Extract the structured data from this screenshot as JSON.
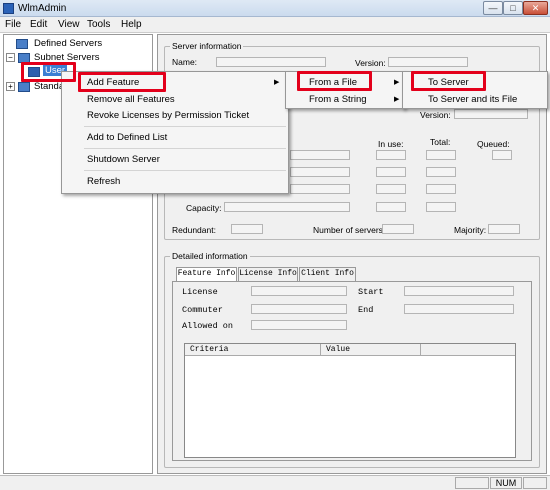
{
  "window": {
    "title": "WlmAdmin",
    "min_symbol": "—",
    "max_symbol": "□",
    "close_symbol": "✕"
  },
  "menubar": [
    "File",
    "Edit",
    "View",
    "Tools",
    "Help"
  ],
  "tree": {
    "defined_servers": "Defined Servers",
    "subnet_servers": "Subnet Servers",
    "selected_node": "User",
    "standalone": "Standa"
  },
  "server_info": {
    "title": "Server information",
    "name_label": "Name:",
    "version_label": "Version:",
    "version2_label": "Version:",
    "in_use_label": "In use:",
    "total_label": "Total:",
    "queued_label": "Queued:",
    "capacity_label": "Capacity:",
    "redundant_label": "Redundant:",
    "num_servers_label": "Number of servers:",
    "majority_label": "Majority:"
  },
  "detailed_info": {
    "title": "Detailed information",
    "tabs": [
      "Feature Info",
      "License Info",
      "Client Info"
    ],
    "license_label": "License",
    "start_label": "Start",
    "commuter_label": "Commuter",
    "end_label": "End",
    "allowed_on_label": "Allowed on",
    "columns": [
      "Criteria",
      "Value"
    ]
  },
  "context_menu": {
    "items": [
      "Add Feature",
      "Remove all Features",
      "Revoke Licenses by Permission Ticket",
      "Add to Defined List",
      "Shutdown Server",
      "Refresh"
    ],
    "submenu1": [
      "From a File",
      "From a String"
    ],
    "submenu2": [
      "To Server",
      "To Server and its File"
    ]
  },
  "statusbar": {
    "num": "NUM"
  },
  "colors": {
    "highlight": "#e3001b",
    "selection": "#3b7fd4"
  }
}
